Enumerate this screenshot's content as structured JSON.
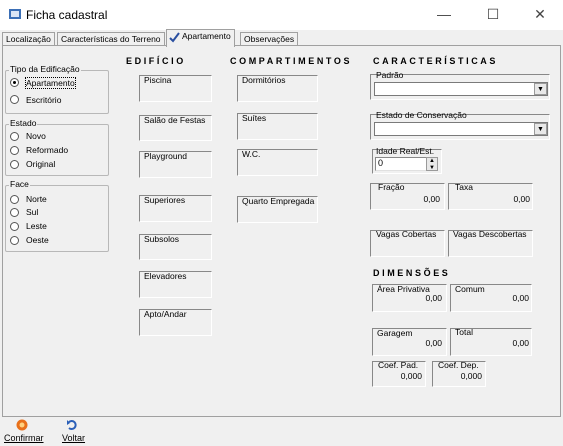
{
  "window": {
    "title": "Ficha cadastral",
    "minimize": "—",
    "maximize": "☐",
    "close": "✕"
  },
  "tabs": [
    {
      "label": "Localização"
    },
    {
      "label": "Características do Terreno"
    },
    {
      "label": "Apartamento"
    },
    {
      "label": "Observações"
    }
  ],
  "tipo": {
    "label": "Tipo da Edificação",
    "options": [
      "Apartamento",
      "Escritório"
    ],
    "selected": "Apartamento"
  },
  "estado": {
    "label": "Estado",
    "options": [
      "Novo",
      "Reformado",
      "Original"
    ]
  },
  "face": {
    "label": "Face",
    "options": [
      "Norte",
      "Sul",
      "Leste",
      "Oeste"
    ]
  },
  "edificio": {
    "title": "EDIFÍCIO",
    "fields": [
      "Piscina",
      "Salão de Festas",
      "Playground",
      "Superiores",
      "Subsolos",
      "Elevadores",
      "Apto/Andar"
    ]
  },
  "compartimentos": {
    "title": "COMPARTIMENTOS",
    "fields": [
      "Dormitórios",
      "Suítes",
      "W.C.",
      "Quarto Empregada"
    ]
  },
  "caracteristicas": {
    "title": "CARACTERÍSTICAS",
    "padrao": "Padrão",
    "estado_conservacao": "Estado de Conservação",
    "idade": {
      "label": "Idade Real/Est.",
      "value": "0"
    },
    "fracao": {
      "label": "Fração",
      "value": "0,00"
    },
    "taxa": {
      "label": "Taxa",
      "value": "0,00"
    },
    "vagas_cobertas": "Vagas Cobertas",
    "vagas_descobertas": "Vagas Descobertas"
  },
  "dimensoes": {
    "title": "DIMENSÕES",
    "area_privativa": {
      "label": "Área Privativa",
      "value": "0,00"
    },
    "comum": {
      "label": "Comum",
      "value": "0,00"
    },
    "garagem": {
      "label": "Garagem",
      "value": "0,00"
    },
    "total": {
      "label": "Total",
      "value": "0,00"
    },
    "coef_pad": {
      "label": "Coef. Pad.",
      "value": "0,000"
    },
    "coef_dep": {
      "label": "Coef. Dep.",
      "value": "0,000"
    }
  },
  "buttons": {
    "confirmar": "Confirmar",
    "voltar": "Voltar"
  },
  "colors": {
    "confirm_icon": "#e8701a",
    "voltar_icon": "#2a5fb8",
    "app_icon": "#3b6fb6"
  }
}
